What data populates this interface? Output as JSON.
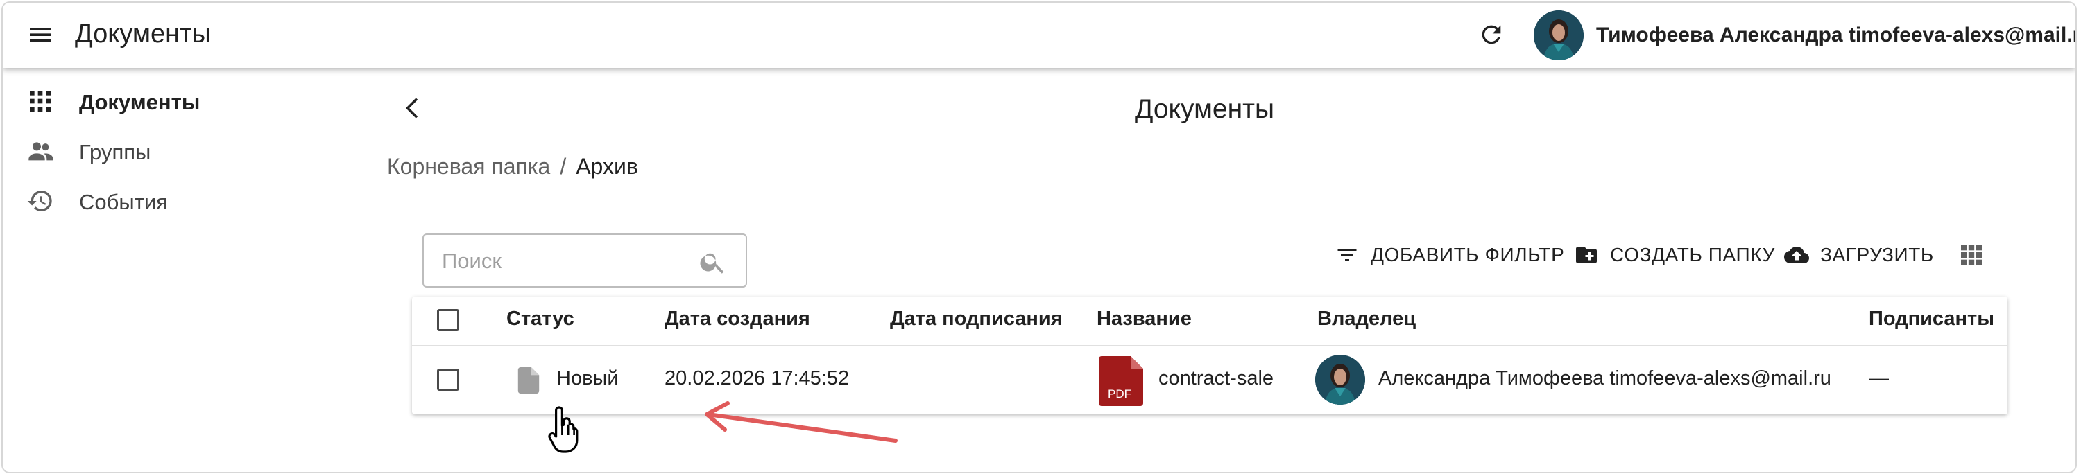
{
  "app": {
    "title": "Документы",
    "user": "Тимофеева Александра timofeeva-alexs@mail.ru"
  },
  "sidebar": {
    "items": [
      {
        "label": "Документы",
        "icon": "apps-grid-icon",
        "active": true
      },
      {
        "label": "Группы",
        "icon": "people-icon",
        "active": false
      },
      {
        "label": "События",
        "icon": "history-icon",
        "active": false
      }
    ]
  },
  "main": {
    "title": "Документы",
    "breadcrumb": {
      "root": "Корневая папка",
      "separator": "/",
      "current": "Архив"
    },
    "search": {
      "placeholder": "Поиск",
      "value": ""
    },
    "toolbar": {
      "add_filter": "ДОБАВИТЬ ФИЛЬТР",
      "create_folder": "СОЗДАТЬ ПАПКУ",
      "upload": "ЗАГРУЗИТЬ"
    }
  },
  "table": {
    "columns": [
      "Статус",
      "Дата создания",
      "Дата подписания",
      "Название",
      "Владелец",
      "Подписанты"
    ],
    "rows": [
      {
        "status": "Новый",
        "created": "20.02.2026 17:45:52",
        "signed": "",
        "name": "contract-sale",
        "file_badge": "PDF",
        "owner": "Александра Тимофеева timofeeva-alexs@mail.ru",
        "signers": "—"
      }
    ]
  },
  "colors": {
    "pdf": "#a11b1b",
    "arrow": "#e05a5a",
    "icon": "#424242",
    "avatar_bg": "#1f4e60"
  }
}
